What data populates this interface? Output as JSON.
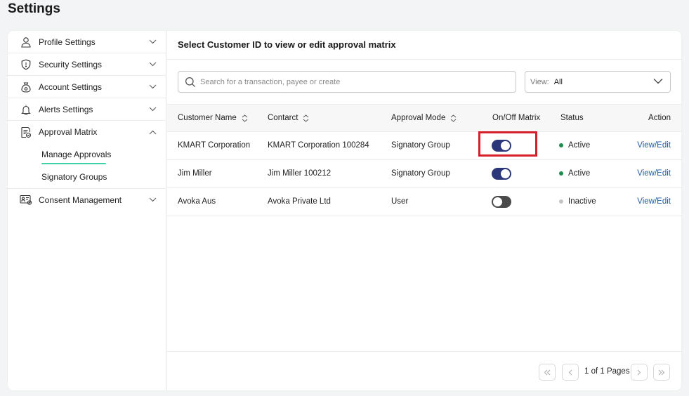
{
  "page": {
    "title": "Settings"
  },
  "sidebar": {
    "items": [
      {
        "label": "Profile Settings",
        "icon": "user-icon"
      },
      {
        "label": "Security Settings",
        "icon": "shield-icon"
      },
      {
        "label": "Account Settings",
        "icon": "money-bag-icon"
      },
      {
        "label": "Alerts Settings",
        "icon": "bell-icon"
      },
      {
        "label": "Approval Matrix",
        "icon": "document-check-icon",
        "expanded": true,
        "subitems": [
          {
            "label": "Manage Approvals",
            "active": true
          },
          {
            "label": "Signatory Groups",
            "active": false
          }
        ]
      },
      {
        "label": "Consent Management",
        "icon": "id-card-icon"
      }
    ]
  },
  "main": {
    "title": "Select Customer ID to view or edit approval matrix",
    "search": {
      "placeholder": "Search for a transaction, payee or create",
      "value": ""
    },
    "view": {
      "label": "View:",
      "value": "All"
    },
    "table": {
      "columns": [
        "Customer Name",
        "Contarct",
        "Approval Mode",
        "On/Off Matrix",
        "Status",
        "Action"
      ],
      "rows": [
        {
          "customer": "KMART Corporation",
          "contract": "KMART Corporation 100284",
          "mode": "Signatory Group",
          "matrix_on": true,
          "status": "Active",
          "action": "View/Edit"
        },
        {
          "customer": "Jim Miller",
          "contract": "Jim Miller 100212",
          "mode": "Signatory Group",
          "matrix_on": true,
          "status": "Active",
          "action": "View/Edit"
        },
        {
          "customer": "Avoka Aus",
          "contract": "Avoka Private Ltd",
          "mode": "User",
          "matrix_on": false,
          "status": "Inactive",
          "action": "View/Edit"
        }
      ]
    },
    "pagination": {
      "text": "1 of 1 Pages"
    }
  },
  "colors": {
    "toggle_on": "#2c3779",
    "toggle_off": "#4a4a4a",
    "status_active": "#1f8a4c",
    "status_inactive": "#c4c4c4",
    "link": "#1f5aa6",
    "accent_underline": "#3fd3a8",
    "highlight": "#d5202a"
  }
}
